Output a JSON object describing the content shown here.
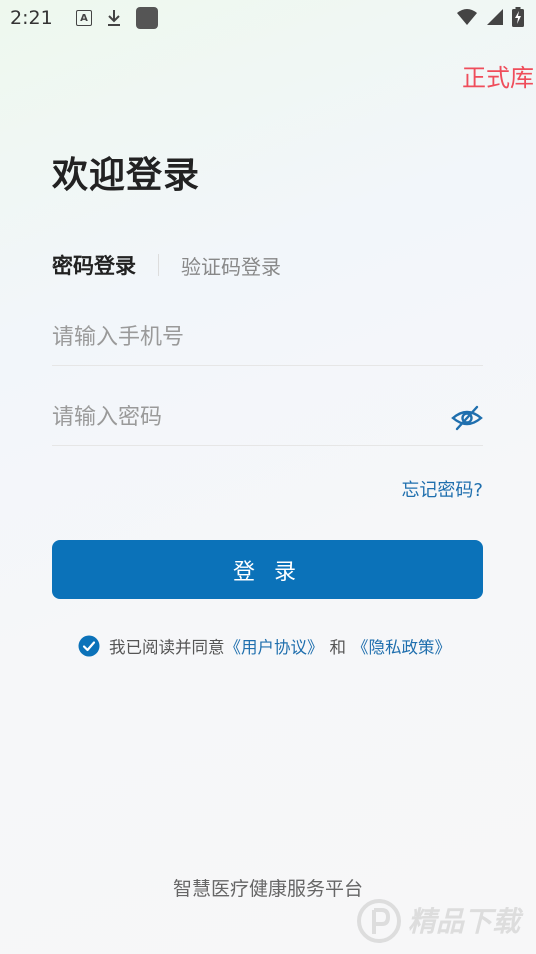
{
  "status_bar": {
    "time": "2:21",
    "a_icon_letter": "A",
    "icons_left": [
      "a-notification-icon",
      "download-icon",
      "app-icon"
    ],
    "icons_right": [
      "wifi-icon",
      "signal-icon",
      "battery-charging-icon"
    ]
  },
  "env_label": "正式库",
  "title": "欢迎登录",
  "tabs": {
    "active": "密码登录",
    "inactive": "验证码登录"
  },
  "phone": {
    "placeholder": "请输入手机号",
    "value": ""
  },
  "password": {
    "placeholder": "请输入密码",
    "value": "",
    "toggle_icon": "eye-off-icon"
  },
  "forgot_password": "忘记密码?",
  "login_button": "登 录",
  "agreement": {
    "checked": true,
    "prefix": "我已阅读并同意",
    "user_agreement": "《用户协议》",
    "and": "和",
    "privacy_policy": "《隐私政策》"
  },
  "footer": "智慧医疗健康服务平台",
  "watermark": "精品下载",
  "colors": {
    "primary": "#0b72b9",
    "link": "#1f6fae",
    "env_label": "#ef4d5b"
  }
}
